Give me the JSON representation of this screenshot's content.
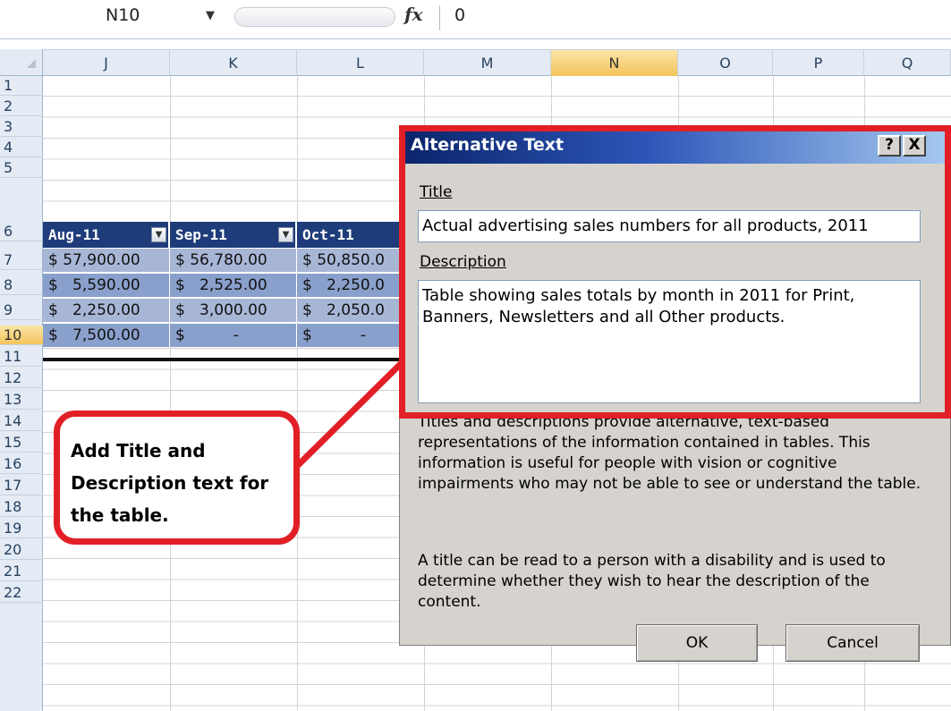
{
  "formula_bar": {
    "name_box": "N10",
    "fx_symbol": "fx",
    "value": "0"
  },
  "columns": [
    "J",
    "K",
    "L",
    "M",
    "N",
    "O",
    "P",
    "Q"
  ],
  "rows": [
    "1",
    "2",
    "3",
    "4",
    "5",
    "6",
    "7",
    "8",
    "9",
    "10",
    "11",
    "12",
    "13",
    "14",
    "15",
    "16",
    "17",
    "18",
    "19",
    "20",
    "21",
    "22"
  ],
  "table": {
    "headers": [
      "Aug-11",
      "Sep-11",
      "Oct-11"
    ],
    "rows": [
      [
        "$ 57,900.00",
        "$ 56,780.00",
        "$ 50,850.0"
      ],
      [
        "$   5,590.00",
        "$   2,525.00",
        "$   2,250.0"
      ],
      [
        "$   2,250.00",
        "$   3,000.00",
        "$   2,050.0"
      ],
      [
        "$   7,500.00",
        "$          -",
        "$          -"
      ]
    ]
  },
  "dialog": {
    "title": "Alternative Text",
    "help_button": "?",
    "close_button": "X",
    "title_label": "Title",
    "title_value": "Actual advertising sales numbers for all products, 2011",
    "description_label": "Description",
    "description_value": "Table showing sales totals by month in 2011 for Print, Banners, Newsletters and all Other products.",
    "help_paragraph_1": "Titles and descriptions provide alternative, text-based representations of the information contained in tables. This information is useful for people with vision or cognitive impairments who may not be able to see or understand the table.",
    "help_paragraph_2": "A title can be read to a person with a disability and is used to determine whether they wish to hear the description of the content.",
    "ok_label": "OK",
    "cancel_label": "Cancel"
  },
  "callout": {
    "text": "Add Title and Description text for the table."
  },
  "colors": {
    "highlight_red": "#e21f26",
    "table_header": "#1f3c7a",
    "table_band_light": "#a8b6d6",
    "table_band_dark": "#8aa0cc",
    "selection_gold": "#f3c45c"
  }
}
